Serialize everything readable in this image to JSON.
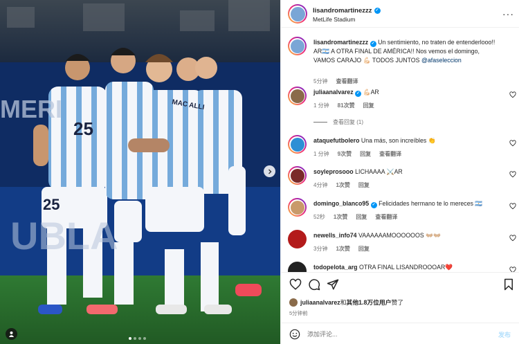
{
  "post": {
    "author": "lisandromartinezzz",
    "location": "MetLife Stadium",
    "more_label": "···"
  },
  "photo": {
    "players": [
      {
        "number": "25"
      },
      {
        "number": "25"
      }
    ],
    "board_text_left": "MERI",
    "board_text_bottom": "UBLA",
    "jersey_name": "MAC ALLI",
    "dots": 4,
    "active_dot": 0
  },
  "caption": {
    "user": "lisandromartinezzz",
    "text": "Un sentimiento, no traten de entenderlooo!! AR🇦🇷 A OTRA FINAL DE AMÉRICA!! Nos vemos el domingo, VAMOS CARAJO 💪🏻 TODOS JUNTOS",
    "mention": "@afaseleccion",
    "time": "5分钟",
    "translate": "查看翻译"
  },
  "comments": [
    {
      "user": "juliaanalvarez",
      "verified": true,
      "text": "💪🏻AR",
      "time": "1 分钟",
      "likes": "81次赞",
      "reply": "回复",
      "translate": "",
      "view_replies": "查看回复 (1)",
      "avatar_color": "#8a6b4a"
    },
    {
      "user": "ataquefutbolero",
      "verified": false,
      "text": "Una más, son increíbles 👏",
      "time": "1 分钟",
      "likes": "9次赞",
      "reply": "回复",
      "translate": "查看翻译",
      "view_replies": "",
      "avatar_color": "#2d8fd5"
    },
    {
      "user": "soyleprosooo",
      "verified": false,
      "text": "LICHAAAA ⚔️AR",
      "time": "4分钟",
      "likes": "1次赞",
      "reply": "回复",
      "translate": "",
      "view_replies": "",
      "avatar_color": "#7a2a2a"
    },
    {
      "user": "domingo_blanco95",
      "verified": false,
      "text": "Felicidades hermano te lo mereces 🇦🇷",
      "time": "52秒",
      "likes": "1次赞",
      "reply": "回复",
      "translate": "查看翻译",
      "view_replies": "",
      "avatar_color": "#c99a6a"
    },
    {
      "user": "newells_info74",
      "verified": false,
      "text": "VAAAAAAMOOOOOOS 👐🏼👐🏼",
      "time": "3分钟",
      "likes": "1次赞",
      "reply": "回复",
      "translate": "",
      "view_replies": "",
      "avatar_color": "#b31b1b"
    },
    {
      "user": "todopelota_arg",
      "verified": false,
      "text": "OTRA FINAL LISANDROOOAR❤️",
      "time": "",
      "likes": "",
      "reply": "",
      "translate": "",
      "view_replies": "",
      "avatar_color": "#222222"
    }
  ],
  "likes_line": {
    "user": "juliaanalvarez",
    "connector": "和",
    "others": "其他1.8万位用户",
    "suffix": "赞了"
  },
  "posted_time": "5分钟前",
  "add_comment": {
    "placeholder": "添加评论...",
    "post_label": "发布"
  },
  "colors": {
    "verified": "#0095f6",
    "link": "#00376b",
    "post_button": "#b2dffc"
  }
}
